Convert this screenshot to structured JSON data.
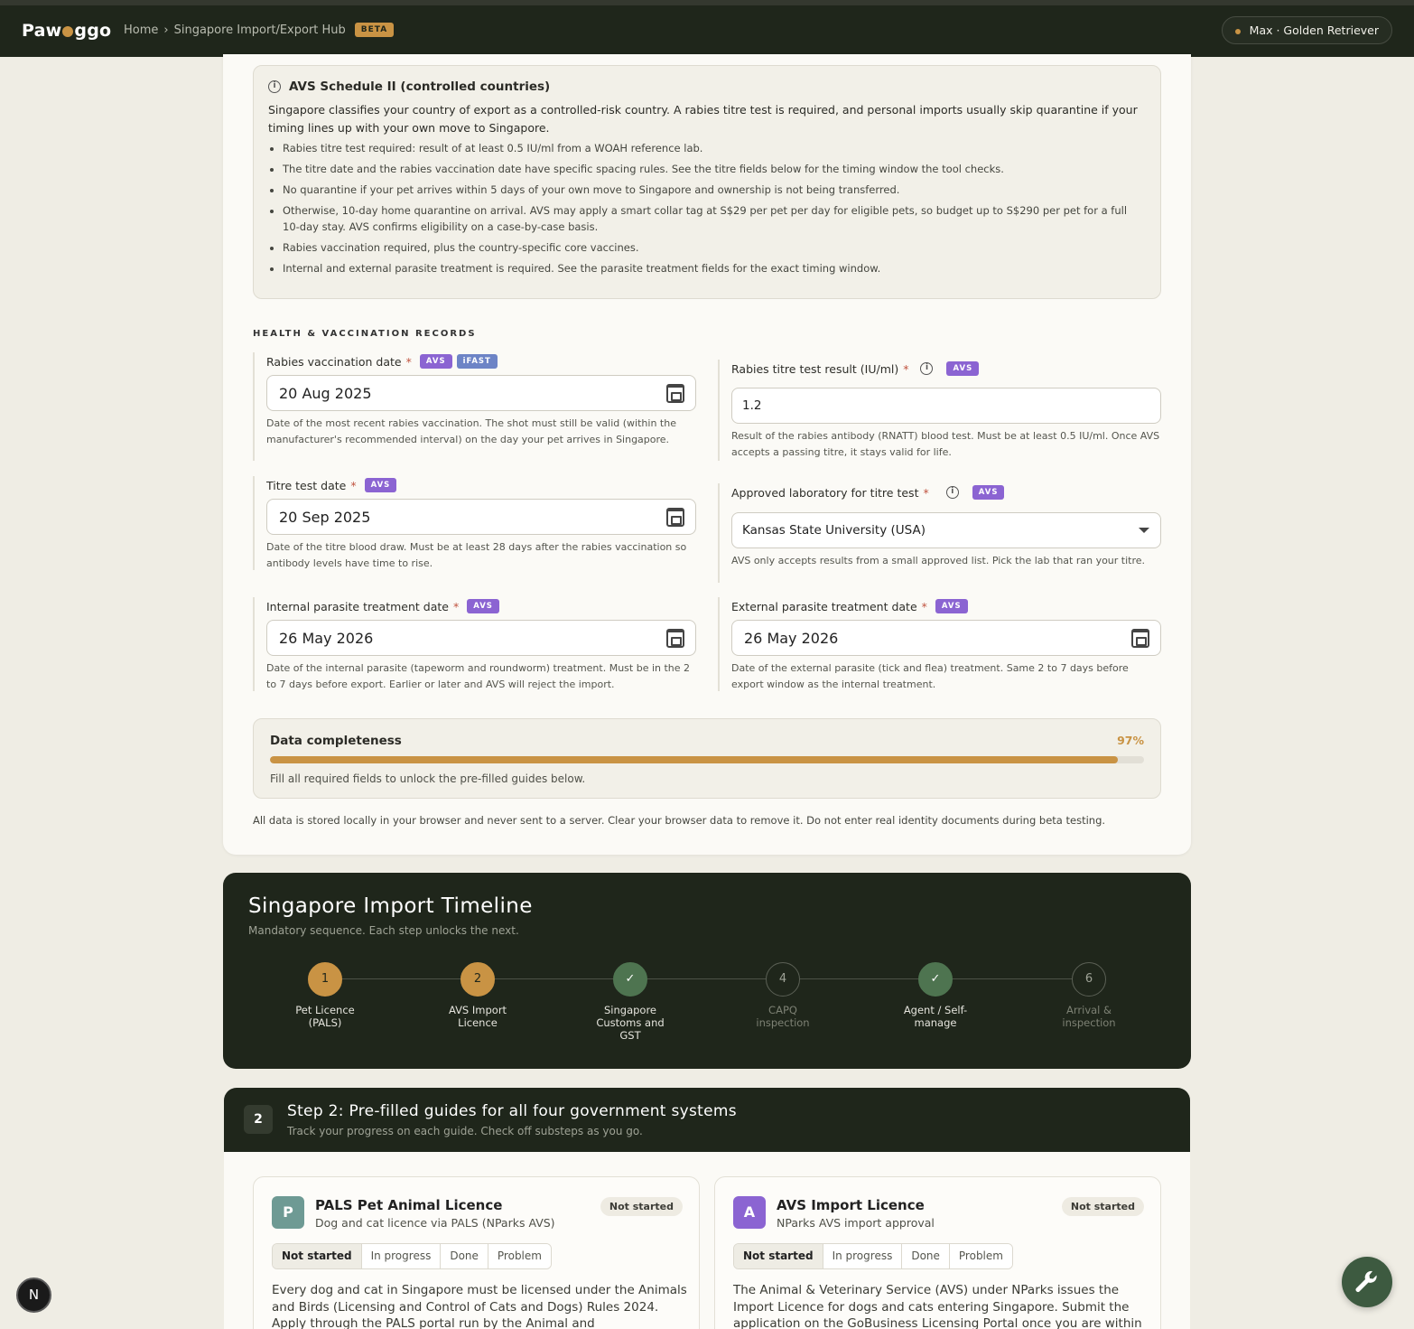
{
  "header": {
    "logo_left": "Paw",
    "logo_right": "ggo",
    "crumb_home": "Home",
    "crumb_sep": "›",
    "crumb_page": "Singapore Import/Export Hub",
    "beta": "BETA",
    "pet": "Max · Golden Retriever"
  },
  "info": {
    "title": "AVS Schedule II (controlled countries)",
    "intro": "Singapore classifies your country of export as a controlled-risk country. A rabies titre test is required, and personal imports usually skip quarantine if your timing lines up with your own move to Singapore.",
    "bullets": [
      "Rabies titre test required: result of at least 0.5 IU/ml from a WOAH reference lab.",
      "The titre date and the rabies vaccination date have specific spacing rules. See the titre fields below for the timing window the tool checks.",
      "No quarantine if your pet arrives within 5 days of your own move to Singapore and ownership is not being transferred.",
      "Otherwise, 10-day home quarantine on arrival. AVS may apply a smart collar tag at S$29 per pet per day for eligible pets, so budget up to S$290 per pet for a full 10-day stay. AVS confirms eligibility on a case-by-case basis.",
      "Rabies vaccination required, plus the country-specific core vaccines.",
      "Internal and external parasite treatment is required. See the parasite treatment fields for the exact timing window."
    ]
  },
  "section_title": "HEALTH & VACCINATION RECORDS",
  "tags": {
    "avs": "AVS",
    "ifast": "iFAST",
    "req": "*"
  },
  "fields": {
    "rabies_date": {
      "label": "Rabies vaccination date",
      "value": "20 Aug 2025",
      "help": "Date of the most recent rabies vaccination. The shot must still be valid (within the manufacturer's recommended interval) on the day your pet arrives in Singapore."
    },
    "titre_result": {
      "label": "Rabies titre test result (IU/ml)",
      "value": "1.2",
      "help": "Result of the rabies antibody (RNATT) blood test. Must be at least 0.5 IU/ml. Once AVS accepts a passing titre, it stays valid for life."
    },
    "titre_date": {
      "label": "Titre test date",
      "value": "20 Sep 2025",
      "help": "Date of the titre blood draw. Must be at least 28 days after the rabies vaccination so antibody levels have time to rise."
    },
    "lab": {
      "label": "Approved laboratory for titre test",
      "value": "Kansas State University (USA)",
      "help": "AVS only accepts results from a small approved list. Pick the lab that ran your titre."
    },
    "internal_parasite": {
      "label": "Internal parasite treatment date",
      "value": "26 May 2026",
      "help": "Date of the internal parasite (tapeworm and roundworm) treatment. Must be in the 2 to 7 days before export. Earlier or later and AVS will reject the import."
    },
    "external_parasite": {
      "label": "External parasite treatment date",
      "value": "26 May 2026",
      "help": "Date of the external parasite (tick and flea) treatment. Same 2 to 7 days before export window as the internal treatment."
    }
  },
  "completeness": {
    "label": "Data completeness",
    "percent_label": "97%",
    "percent": 97,
    "note": "Fill all required fields to unlock the pre-filled guides below."
  },
  "privacy": "All data is stored locally in your browser and never sent to a server. Clear your browser data to remove it. Do not enter real identity documents during beta testing.",
  "timeline": {
    "title": "Singapore Import Timeline",
    "subtitle": "Mandatory sequence. Each step unlocks the next.",
    "steps": [
      {
        "mark": "1",
        "label": "Pet Licence (PALS)",
        "state": "active"
      },
      {
        "mark": "2",
        "label": "AVS Import Licence",
        "state": "active"
      },
      {
        "mark": "✓",
        "label": "Singapore Customs and GST",
        "state": "done"
      },
      {
        "mark": "4",
        "label": "CAPQ inspection",
        "state": "pending"
      },
      {
        "mark": "✓",
        "label": "Agent / Self-manage",
        "state": "done"
      },
      {
        "mark": "6",
        "label": "Arrival & inspection",
        "state": "pending"
      }
    ]
  },
  "step2": {
    "number": "2",
    "title": "Step 2: Pre-filled guides for all four government systems",
    "subtitle": "Track your progress on each guide. Check off substeps as you go.",
    "segments": [
      "Not started",
      "In progress",
      "Done",
      "Problem"
    ],
    "guides": [
      {
        "icon": "P",
        "color": "#6e9a94",
        "title": "PALS Pet Animal Licence",
        "subtitle": "Dog and cat licence via PALS (NParks AVS)",
        "status": "Not started",
        "desc": "Every dog and cat in Singapore must be licensed under the Animals and Birds (Licensing and Control of Cats and Dogs) Rules 2024. Apply through the PALS portal run by the Animal and"
      },
      {
        "icon": "A",
        "color": "#8b64d2",
        "title": "AVS Import Licence",
        "subtitle": "NParks AVS import approval",
        "status": "Not started",
        "desc": "The Animal & Veterinary Service (AVS) under NParks issues the Import Licence for dogs and cats entering Singapore. Submit the application on the GoBusiness Licensing Portal once you are within"
      }
    ]
  },
  "floating": {
    "badge": "N"
  },
  "colors": {
    "accent": "#c99344",
    "dark": "#1f261b",
    "avs_tag": "#8b64d2"
  }
}
